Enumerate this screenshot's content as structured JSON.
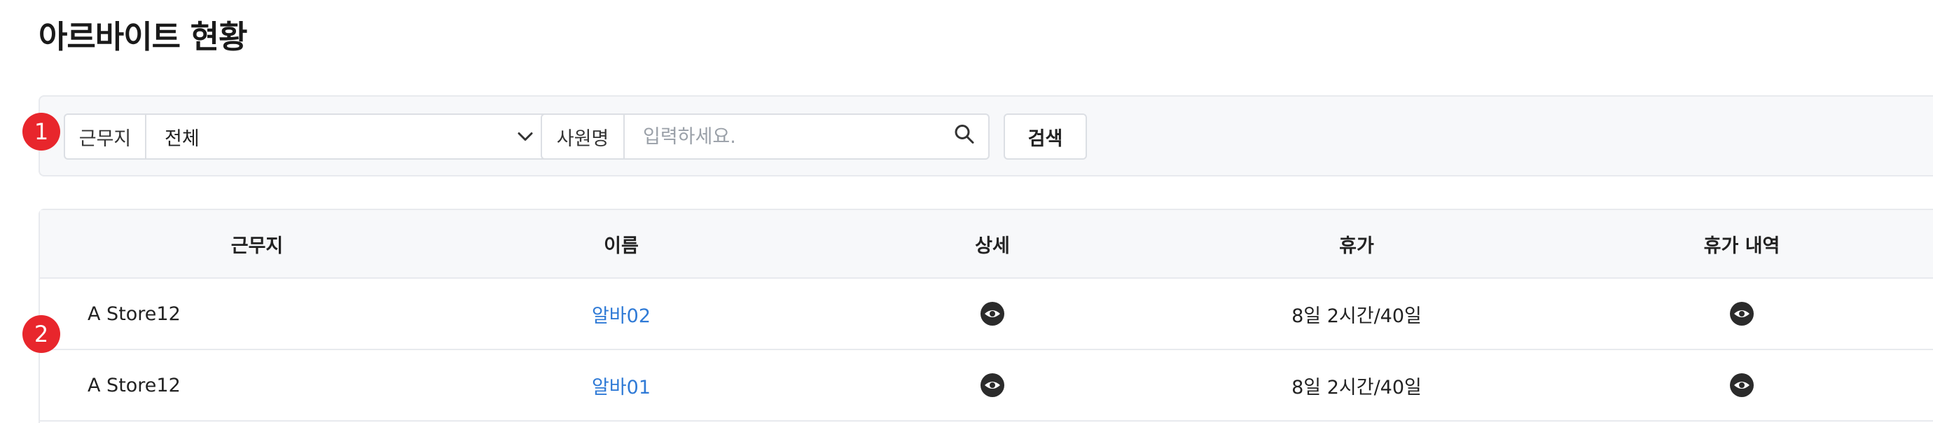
{
  "page": {
    "title": "아르바이트 현황"
  },
  "markers": [
    "1",
    "2"
  ],
  "filters": {
    "workplace": {
      "label": "근무지",
      "value": "전체"
    },
    "employee": {
      "label": "사원명",
      "placeholder": "입력하세요."
    },
    "search_button": "검색"
  },
  "table": {
    "headers": [
      "근무지",
      "이름",
      "상세",
      "휴가",
      "휴가 내역"
    ],
    "rows": [
      {
        "workplace": "A Store12",
        "name": "알바02",
        "vacation": "8일 2시간/40일"
      },
      {
        "workplace": "A Store12",
        "name": "알바01",
        "vacation": "8일 2시간/40일"
      }
    ]
  },
  "colors": {
    "accent_link": "#2f7ad6",
    "marker": "#e8262c"
  }
}
